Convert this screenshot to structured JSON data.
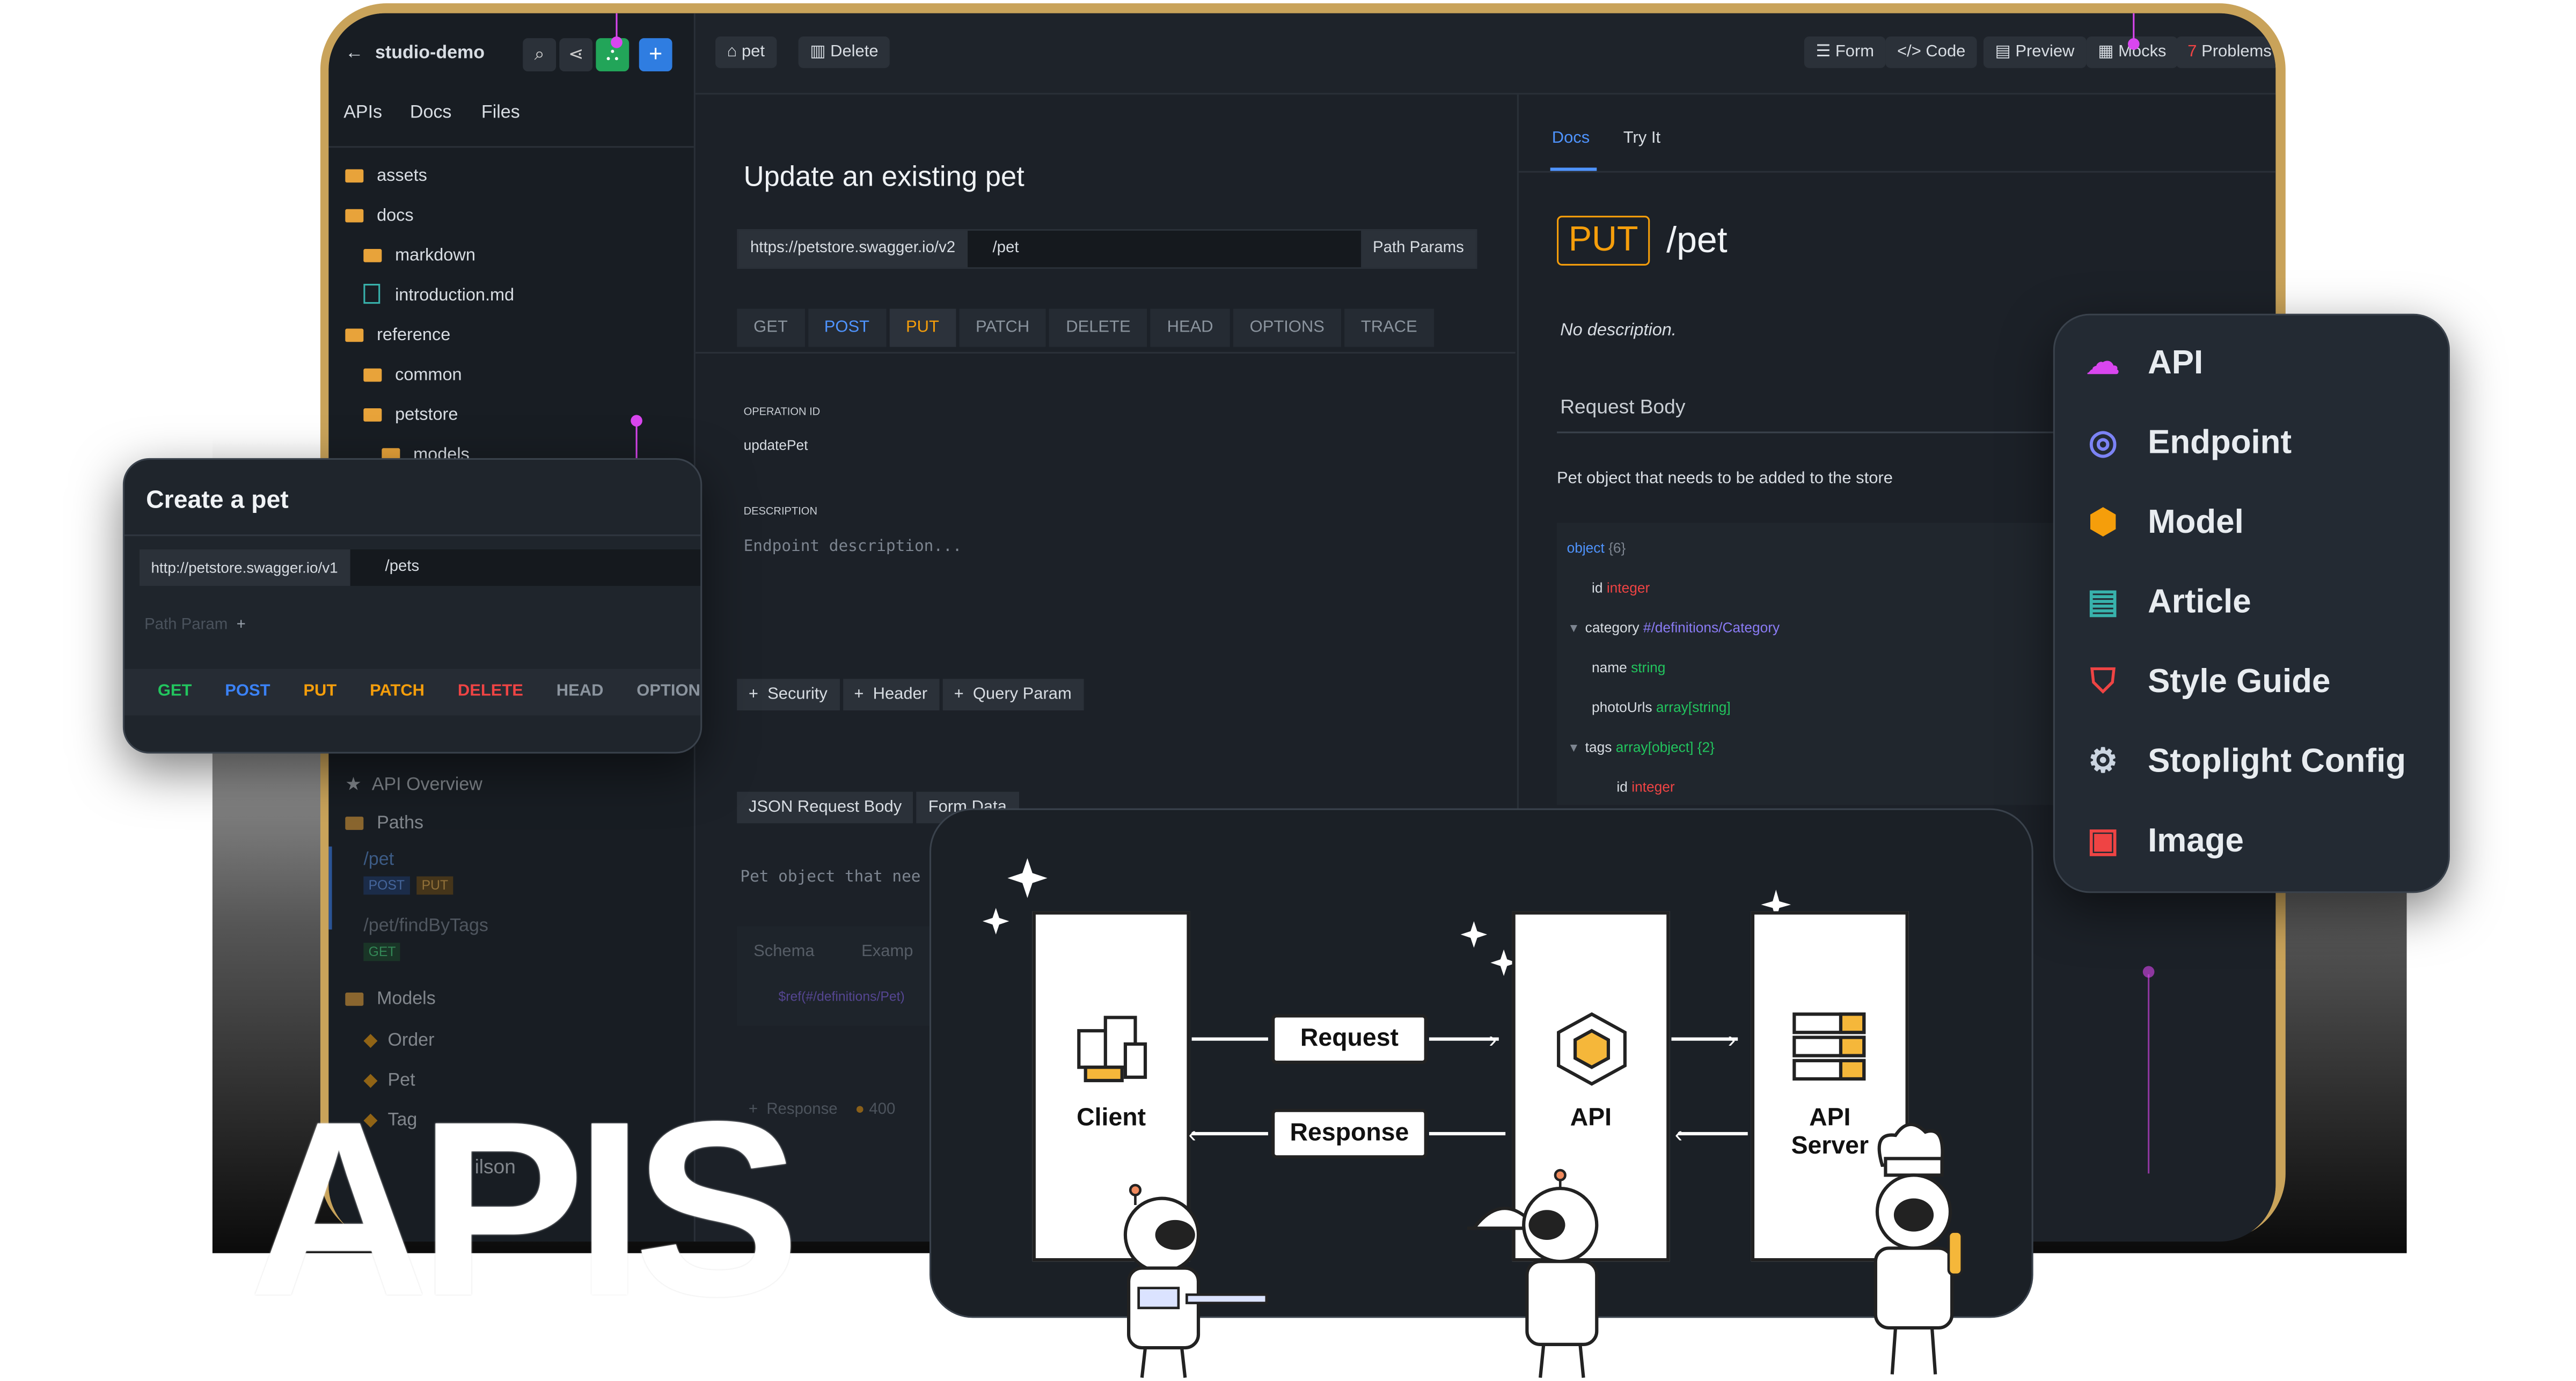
{
  "toolbar": {
    "project": "studio-demo",
    "tag_label": "pet",
    "delete_label": "Delete",
    "form_label": "Form",
    "code_label": "Code",
    "preview_label": "Preview",
    "mocks_label": "Mocks",
    "problems_count": "7",
    "problems_label": "Problems"
  },
  "sidebar": {
    "tabs": [
      "APIs",
      "Docs",
      "Files"
    ],
    "tree": [
      "assets",
      "docs",
      "markdown",
      "introduction.md",
      "reference",
      "common",
      "petstore",
      "models"
    ],
    "nav": {
      "overview": "API Overview",
      "paths": "Paths",
      "path1": "/pet",
      "path1_methods": [
        "POST",
        "PUT"
      ],
      "path2": "/pet/findByTags",
      "path2_methods": [
        "GET"
      ],
      "models": "Models",
      "model_items": [
        "Order",
        "Pet",
        "Tag"
      ],
      "user": "Je   ilson"
    }
  },
  "editor": {
    "title": "Update an existing pet",
    "server": "https://petstore.swagger.io/v2",
    "path": "/pet",
    "path_params": "Path Params",
    "methods": [
      "GET",
      "POST",
      "PUT",
      "PATCH",
      "DELETE",
      "HEAD",
      "OPTIONS",
      "TRACE"
    ],
    "operation_id_label": "OPERATION ID",
    "operation_id": "updatePet",
    "description_label": "DESCRIPTION",
    "description_placeholder": "Endpoint description...",
    "add_buttons": [
      "Security",
      "Header",
      "Query Param"
    ],
    "body_tabs": [
      "JSON Request Body",
      "Form Data"
    ],
    "body_desc": "Pet object that nee",
    "schema_tabs": [
      "Schema",
      "Examp"
    ],
    "schema_ref": "$ref(#/definitions/Pet)",
    "response_label": "Response",
    "response_code": "400"
  },
  "docs": {
    "tabs": [
      "Docs",
      "Try It"
    ],
    "method": "PUT",
    "path": "/pet",
    "no_description": "No description.",
    "request_body": "Request Body",
    "body_description": "Pet object that needs to be added to the store",
    "schema": [
      {
        "name": "object",
        "type": "{6}"
      },
      {
        "name": "id",
        "type": "integer"
      },
      {
        "name": "category",
        "type": "#/definitions/Category"
      },
      {
        "name": "name",
        "type": "string"
      },
      {
        "name": "photoUrls",
        "type": "array[string]"
      },
      {
        "name": "tags",
        "type": "array[object]  {2}"
      },
      {
        "name": "id",
        "type": "integer"
      }
    ]
  },
  "popup": {
    "title": "Create a pet",
    "server": "http://petstore.swagger.io/v1",
    "path": "/pets",
    "path_param": "Path Param",
    "methods": [
      "GET",
      "POST",
      "PUT",
      "PATCH",
      "DELETE",
      "HEAD",
      "OPTION"
    ]
  },
  "create_menu": {
    "items": [
      {
        "label": "API",
        "icon": "cloud-icon",
        "color": "#d946ef"
      },
      {
        "label": "Endpoint",
        "icon": "target-icon",
        "color": "#7c83f5"
      },
      {
        "label": "Model",
        "icon": "cube-icon",
        "color": "#f59e0b"
      },
      {
        "label": "Article",
        "icon": "book-icon",
        "color": "#38b2ac"
      },
      {
        "label": "Style Guide",
        "icon": "shield-icon",
        "color": "#ef4444"
      },
      {
        "label": "Stoplight Config",
        "icon": "gear-icon",
        "color": "#cbd5e1"
      },
      {
        "label": "Image",
        "icon": "image-file-icon",
        "color": "#ef4444"
      }
    ]
  },
  "diagram": {
    "client": "Client",
    "api": "API",
    "server": "API\nServer",
    "request": "Request",
    "response": "Response"
  },
  "headline": "APIS",
  "colors": {
    "frame": "#c9a35a",
    "bg": "#1c2128",
    "post": "#3b82f6",
    "put": "#f59e0b",
    "get": "#22c55e",
    "delete": "#ef4444",
    "accent_pink": "#d946ef"
  }
}
